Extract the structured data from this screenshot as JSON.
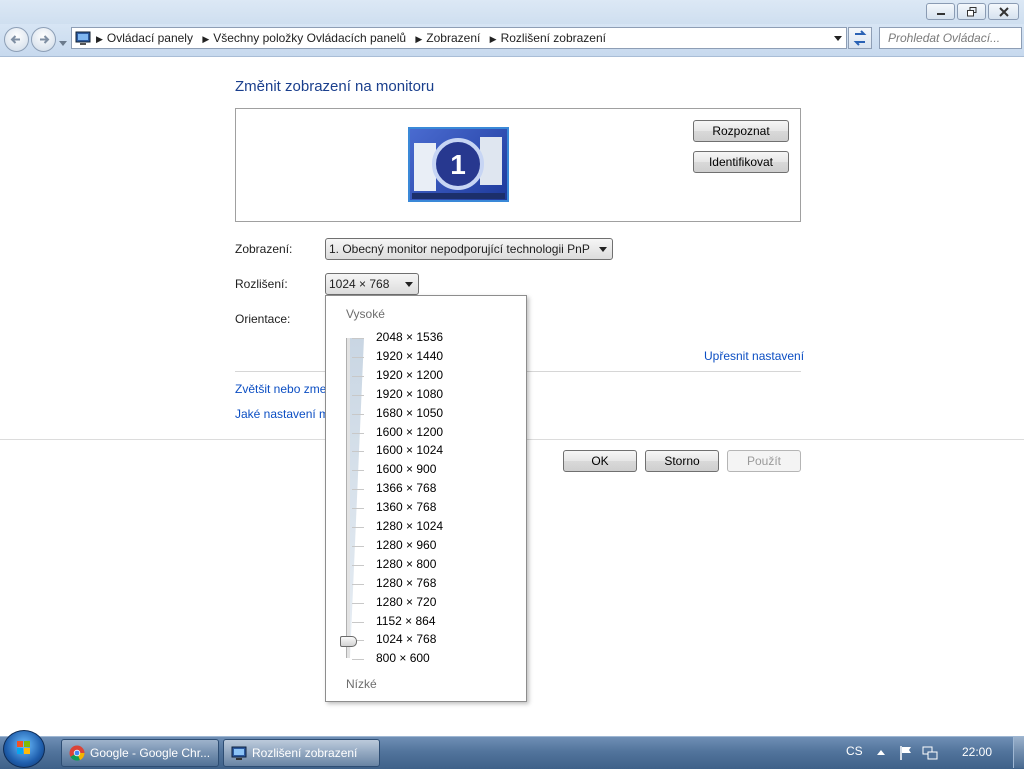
{
  "address": {
    "crumbs": [
      "Ovládací panely",
      "Všechny položky Ovládacích panelů",
      "Zobrazení",
      "Rozlišení zobrazení"
    ],
    "search_placeholder": "Prohledat Ovládací..."
  },
  "main": {
    "title": "Změnit zobrazení na monitoru",
    "monitor_number": "1",
    "detect_label": "Rozpoznat",
    "identify_label": "Identifikovat",
    "display_label": "Zobrazení:",
    "display_value": "1. Obecný monitor nepodporující technologii PnP",
    "resolution_label": "Rozlišení:",
    "resolution_value": "1024 × 768",
    "orientation_label": "Orientace:",
    "advanced_link": "Upřesnit nastavení",
    "link_zoom": "Zvětšit nebo zme",
    "link_settings": "Jaké nastavení m",
    "ok_label": "OK",
    "cancel_label": "Storno",
    "apply_label": "Použít"
  },
  "dropdown": {
    "high_label": "Vysoké",
    "low_label": "Nízké",
    "options": [
      "2048 × 1536",
      "1920 × 1440",
      "1920 × 1200",
      "1920 × 1080",
      "1680 × 1050",
      "1600 × 1200",
      "1600 × 1024",
      "1600 × 900",
      "1366 × 768",
      "1360 × 768",
      "1280 × 1024",
      "1280 × 960",
      "1280 × 800",
      "1280 × 768",
      "1280 × 720",
      "1152 × 864",
      "1024 × 768",
      "800 × 600"
    ],
    "selected": "1024 × 768"
  },
  "taskbar": {
    "tasks": [
      "Google - Google Chr...",
      "Rozlišení zobrazení"
    ],
    "active_task": "Rozlišení zobrazení",
    "lang": "CS",
    "clock": "22:00"
  },
  "colors": {
    "link": "#0b4ec3",
    "title": "#1a3f8d",
    "taskbar": "#52749c"
  }
}
